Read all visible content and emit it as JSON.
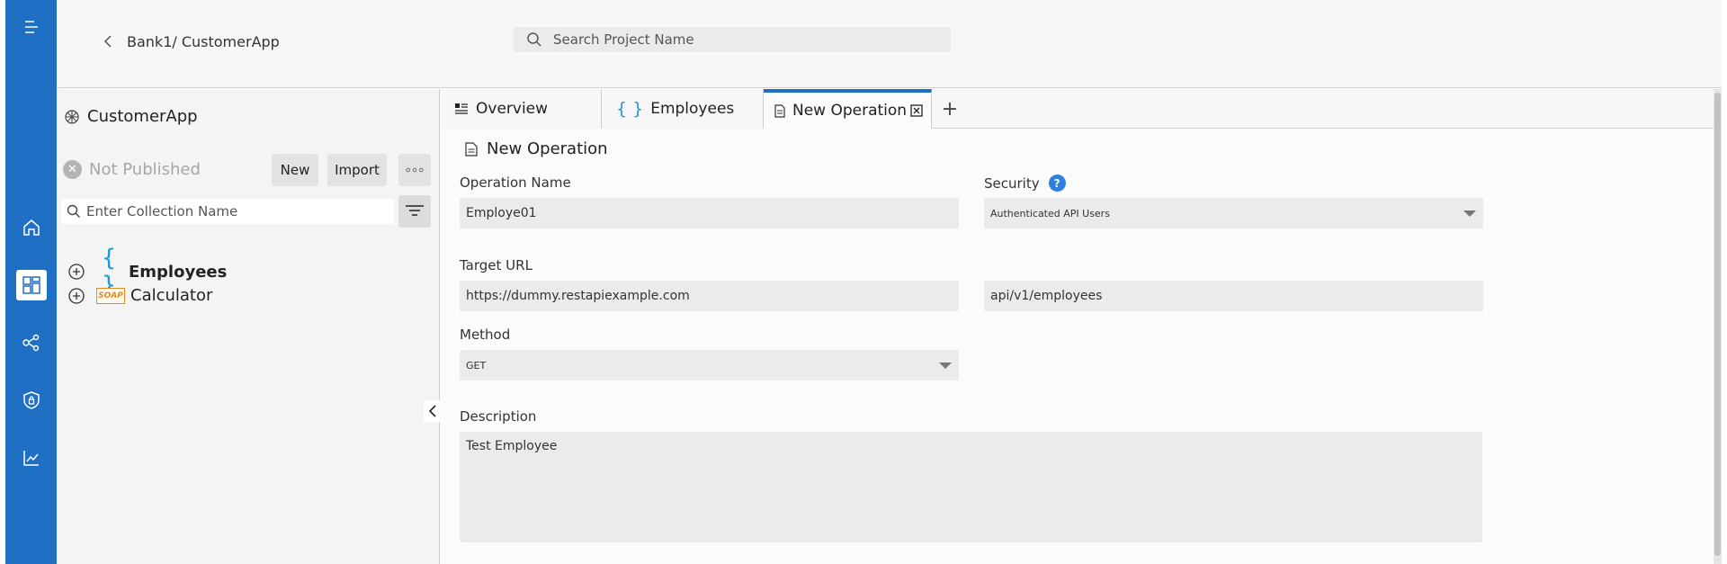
{
  "header": {
    "breadcrumb": "Bank1/ CustomerApp",
    "search_placeholder": "Search Project Name"
  },
  "rail": {
    "items": [
      "menu-icon",
      "home-icon",
      "dashboard-icon",
      "share-icon",
      "security-shield-icon",
      "analytics-icon"
    ],
    "active": "dashboard-icon",
    "color": "#1f6fc5"
  },
  "sidebar": {
    "app_name": "CustomerApp",
    "status": "Not Published",
    "new_label": "New",
    "import_label": "Import",
    "collection_placeholder": "Enter Collection Name",
    "collections": [
      {
        "name": "Employees",
        "type": "rest"
      },
      {
        "name": "Calculator",
        "type": "soap",
        "badge": "SOAP"
      }
    ]
  },
  "tabs": [
    {
      "label": "Overview"
    },
    {
      "label": "Employees"
    },
    {
      "label": "New Operation",
      "active": true
    }
  ],
  "form": {
    "title": "New Operation",
    "operation_name_label": "Operation Name",
    "operation_name_value": "Employe01",
    "security_label": "Security",
    "security_help": "?",
    "security_value": "Authenticated API Users",
    "target_url_label": "Target URL",
    "target_url_value": "https://dummy.restapiexample.com",
    "path_value": "api/v1/employees",
    "method_label": "Method",
    "method_value": "GET",
    "description_label": "Description",
    "description_value": "Test Employee"
  }
}
